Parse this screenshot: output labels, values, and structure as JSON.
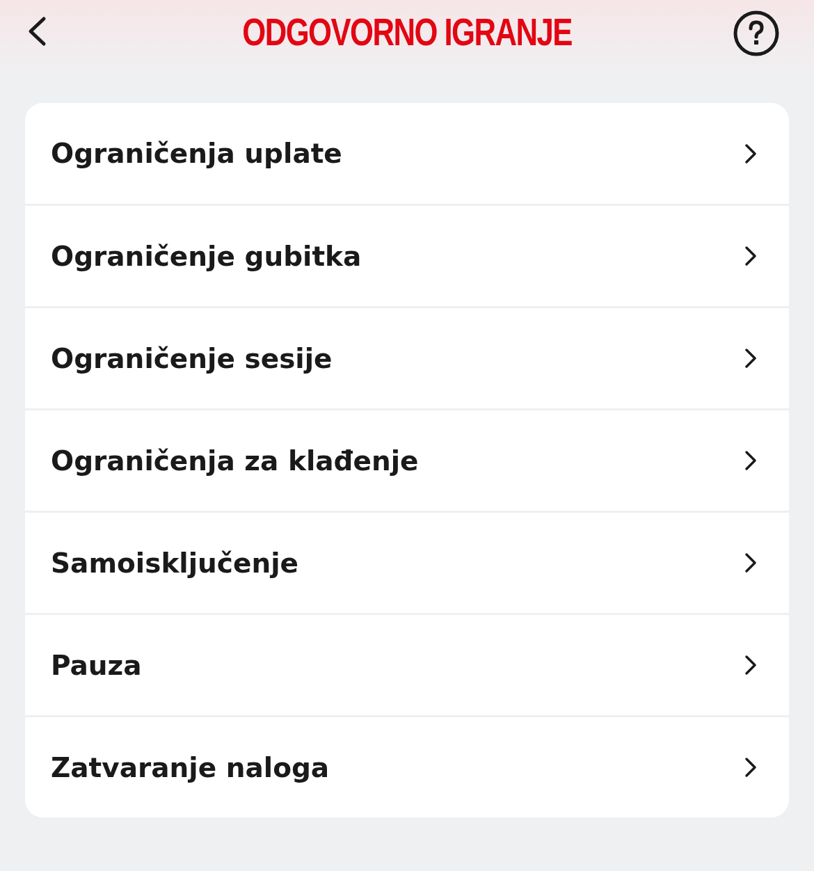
{
  "header": {
    "title": "ODGOVORNO IGRANJE"
  },
  "menu": [
    {
      "label": "Ograničenja uplate"
    },
    {
      "label": "Ograničenje gubitka"
    },
    {
      "label": "Ograničenje sesije"
    },
    {
      "label": "Ograničenja za klađenje"
    },
    {
      "label": "Samoisključenje"
    },
    {
      "label": "Pauza"
    },
    {
      "label": "Zatvaranje naloga"
    }
  ]
}
